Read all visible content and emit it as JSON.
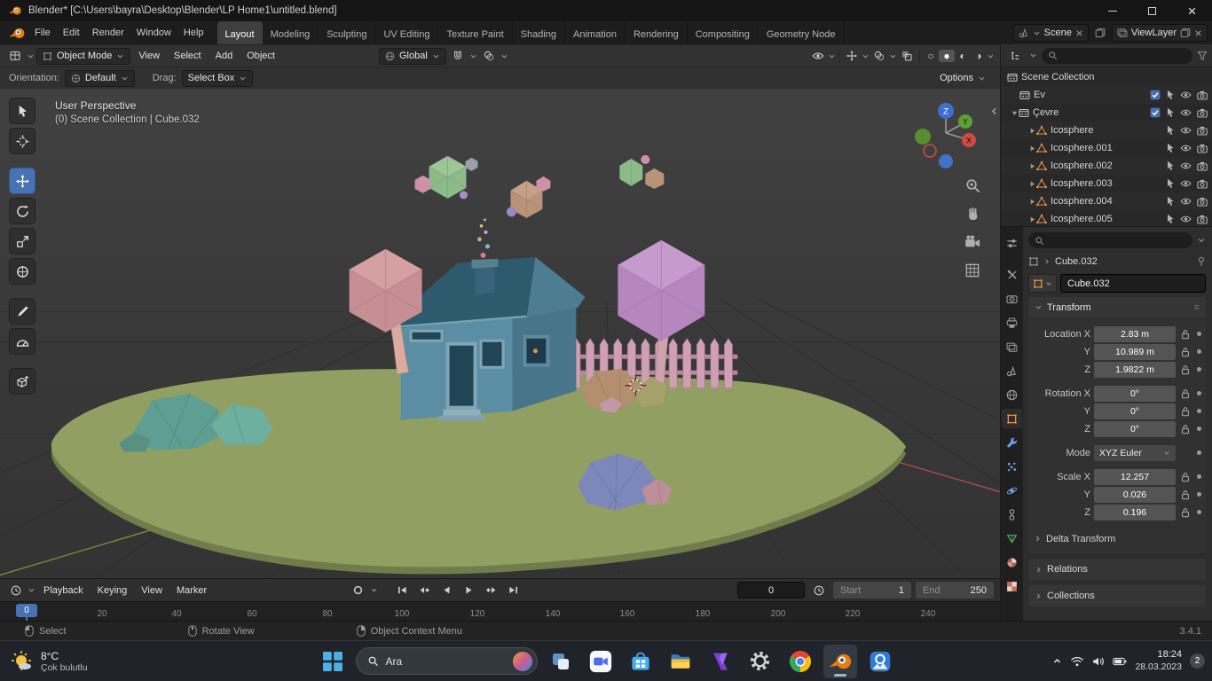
{
  "colors": {
    "accent_blue": "#4772b3",
    "object_orange": "#e8923c",
    "island_green": "#91a062",
    "header_bg": "#323232"
  },
  "titlebar": {
    "title": "Blender* [C:\\Users\\bayra\\Desktop\\Blender\\LP Home1\\untitled.blend]"
  },
  "menubar": {
    "menus": [
      "File",
      "Edit",
      "Render",
      "Window",
      "Help"
    ],
    "workspaces": [
      "Layout",
      "Modeling",
      "Sculpting",
      "UV Editing",
      "Texture Paint",
      "Shading",
      "Animation",
      "Rendering",
      "Compositing",
      "Geometry Node"
    ],
    "scene_label": "Scene",
    "viewlayer_label": "ViewLayer"
  },
  "toolheader": {
    "mode": "Object Mode",
    "menus": [
      "View",
      "Select",
      "Add",
      "Object"
    ],
    "orientation": "Global"
  },
  "toolsettings": {
    "orientation_label": "Orientation:",
    "orientation_value": "Default",
    "drag_label": "Drag:",
    "drag_value": "Select Box",
    "options_label": "Options"
  },
  "viewport": {
    "overlay_title": "User Perspective",
    "overlay_subtitle": "(0) Scene Collection | Cube.032"
  },
  "outliner": {
    "root_label": "Scene Collection",
    "rows": [
      {
        "label": "Ev"
      },
      {
        "label": "Çevre"
      },
      {
        "label": "Icosphere"
      },
      {
        "label": "Icosphere.001"
      },
      {
        "label": "Icosphere.002"
      },
      {
        "label": "Icosphere.003"
      },
      {
        "label": "Icosphere.004"
      },
      {
        "label": "Icosphere.005"
      }
    ]
  },
  "properties": {
    "breadcrumb": "Cube.032",
    "object_name": "Cube.032",
    "transform_title": "Transform",
    "rows": [
      {
        "label": "Location X",
        "value": "2.83 m"
      },
      {
        "label": "Y",
        "value": "10.989 m"
      },
      {
        "label": "Z",
        "value": "1.9822 m"
      },
      {
        "label": "Rotation X",
        "value": "0°"
      },
      {
        "label": "Y",
        "value": "0°"
      },
      {
        "label": "Z",
        "value": "0°"
      },
      {
        "label": "Scale X",
        "value": "12.257"
      },
      {
        "label": "Y",
        "value": "0.026"
      },
      {
        "label": "Z",
        "value": "0.196"
      }
    ],
    "mode_label": "Mode",
    "mode_value": "XYZ Euler",
    "sections": [
      "Delta Transform",
      "Relations",
      "Collections"
    ]
  },
  "timeline": {
    "menus": [
      "Playback",
      "Keying",
      "View",
      "Marker"
    ],
    "current_frame": "0",
    "playhead_label": "0",
    "start_label": "Start",
    "start_value": "1",
    "end_label": "End",
    "end_value": "250",
    "ticks": [
      "20",
      "40",
      "60",
      "80",
      "100",
      "120",
      "140",
      "160",
      "180",
      "200",
      "220",
      "240"
    ]
  },
  "statusbar": {
    "hints": [
      "Select",
      "Rotate View",
      "Object Context Menu"
    ],
    "version": "3.4.1"
  },
  "taskbar": {
    "weather_temp": "8°C",
    "weather_desc": "Çok bulutlu",
    "search_placeholder": "Ara",
    "clock_time": "18:24",
    "clock_date": "28.03.2023",
    "badge_count": "2"
  }
}
